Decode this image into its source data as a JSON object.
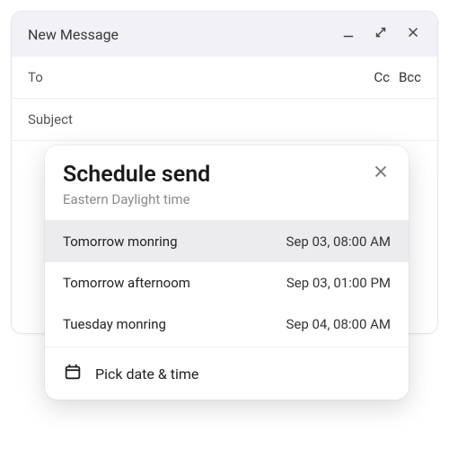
{
  "compose": {
    "title": "New Message",
    "fields": {
      "to_label": "To",
      "cc_label": "Cc",
      "bcc_label": "Bcc",
      "subject_label": "Subject"
    }
  },
  "schedule": {
    "title": "Schedule send",
    "timezone": "Eastern Daylight time",
    "options": [
      {
        "label": "Tomorrow monring",
        "time": "Sep 03, 08:00 AM",
        "selected": true
      },
      {
        "label": "Tomorrow afternoom",
        "time": "Sep 03, 01:00 PM",
        "selected": false
      },
      {
        "label": "Tuesday monring",
        "time": "Sep 04, 08:00 AM",
        "selected": false
      }
    ],
    "pick_label": "Pick date & time"
  }
}
